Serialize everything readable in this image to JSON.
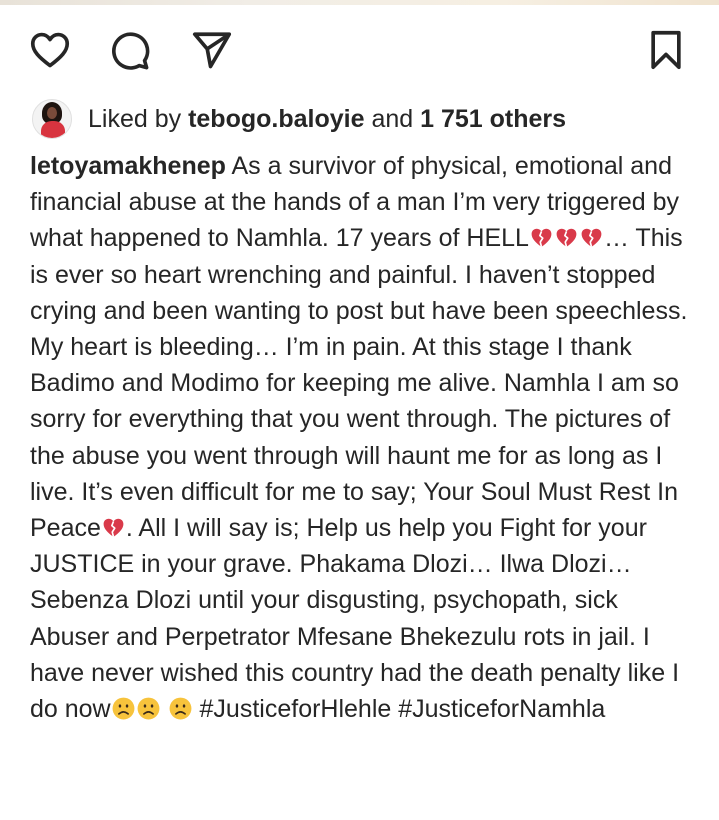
{
  "post": {
    "actions": {
      "like_icon": "heart-outline-icon",
      "comment_icon": "comment-bubble-icon",
      "share_icon": "paper-plane-icon",
      "save_icon": "bookmark-icon"
    },
    "likes": {
      "prefix": "Liked by",
      "user": "tebogo.baloyie",
      "connector": "and",
      "others": "1 751 others"
    },
    "caption": {
      "username": "letoyamakhenep",
      "text_1": "As a survivor of physical, emotional and financial abuse at the hands of a man I’m very triggered by what happened to Namhla. 17 years of HELL",
      "text_2": "… This is ever so heart wrenching and painful. I haven’t stopped crying and been wanting to post but have been speechless. My heart is bleeding… I’m in pain. At this stage I thank Badimo and Modimo for keeping me alive. Namhla I am so sorry for everything that you went through. The pictures of the abuse you went through will haunt me for as long as I live. It’s even difficult for me to say; Your Soul Must Rest In Peace",
      "text_3": ". All I will say is; Help us help you Fight for your JUSTICE in your grave. Phakama Dlozi… Ilwa Dlozi… Sebenza Dlozi until your disgusting, psychopath, sick Abuser and Perpetrator Mfesane Bhekezulu rots in jail. I have never wished this country had the death penalty like I do now",
      "hashtag_1": "#JusticeforHlehle",
      "hashtag_2": "#JusticeforNamhla"
    },
    "emoji": {
      "broken_heart": "broken-heart-emoji",
      "sad_face": "frowning-face-emoji"
    },
    "colors": {
      "text": "#262626",
      "broken_heart": "#d93a4a",
      "sad_face": "#f7c33c"
    }
  }
}
